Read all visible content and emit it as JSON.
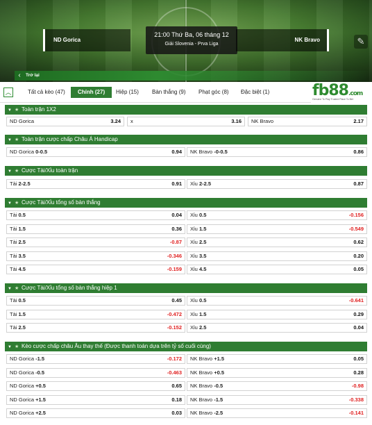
{
  "header": {
    "home_team": "ND Gorica",
    "away_team": "NK Bravo",
    "match_time": "21:00 Thứ Ba, 06 tháng 12",
    "league": "Giải Slovenia - Prva Liga",
    "back_label": "Trở lại",
    "side_icon": "pin-icon"
  },
  "tabs": [
    {
      "label": "Tất cả kèo (47)"
    },
    {
      "label": "Chính (27)"
    },
    {
      "label": "Hiệp (15)"
    },
    {
      "label": "Bàn thắng (9)"
    },
    {
      "label": "Phạt góc (8)"
    },
    {
      "label": "Đặc biệt (1)"
    }
  ],
  "logo": {
    "brand_main": "fb",
    "brand_accent": "88",
    "brand_suffix": ".com",
    "tagline": "Genuine To Play     Trusted Place To Bet"
  },
  "colors": {
    "accent_green": "#2f7d32",
    "negative_red": "#e02020"
  },
  "sections": {
    "s1": {
      "title": "Toàn trận 1X2",
      "rows": [
        [
          {
            "label": "ND Gorica",
            "value": "3.24"
          },
          {
            "label": "x",
            "value": "3.16"
          },
          {
            "label": "NK Bravo",
            "value": "2.17"
          }
        ]
      ]
    },
    "s2": {
      "title": "Toàn trận cược chấp Châu Á Handicap",
      "rows": [
        [
          {
            "label": "ND Gorica",
            "label_bold": "0-0.5",
            "value": "0.94"
          },
          {
            "label": "NK Bravo",
            "label_bold": "-0-0.5",
            "value": "0.86"
          }
        ]
      ]
    },
    "s3": {
      "title": "Cược Tài/Xỉu toàn trận",
      "rows": [
        [
          {
            "label": "Tài",
            "label_bold": "2-2.5",
            "value": "0.91"
          },
          {
            "label": "Xỉu",
            "label_bold": "2-2.5",
            "value": "0.87"
          }
        ]
      ]
    },
    "s4": {
      "title": "Cược Tài/Xỉu tổng số bàn thắng",
      "rows": [
        [
          {
            "label": "Tài",
            "label_bold": "0.5",
            "value": "0.04"
          },
          {
            "label": "Xỉu",
            "label_bold": "0.5",
            "value": "-0.156"
          }
        ],
        [
          {
            "label": "Tài",
            "label_bold": "1.5",
            "value": "0.36"
          },
          {
            "label": "Xỉu",
            "label_bold": "1.5",
            "value": "-0.549"
          }
        ],
        [
          {
            "label": "Tài",
            "label_bold": "2.5",
            "value": "-0.87"
          },
          {
            "label": "Xỉu",
            "label_bold": "2.5",
            "value": "0.62"
          }
        ],
        [
          {
            "label": "Tài",
            "label_bold": "3.5",
            "value": "-0.346"
          },
          {
            "label": "Xỉu",
            "label_bold": "3.5",
            "value": "0.20"
          }
        ],
        [
          {
            "label": "Tài",
            "label_bold": "4.5",
            "value": "-0.159"
          },
          {
            "label": "Xỉu",
            "label_bold": "4.5",
            "value": "0.05"
          }
        ]
      ]
    },
    "s5": {
      "title": "Cược Tài/Xỉu tổng số bàn thắng hiệp 1",
      "rows": [
        [
          {
            "label": "Tài",
            "label_bold": "0.5",
            "value": "0.45"
          },
          {
            "label": "Xỉu",
            "label_bold": "0.5",
            "value": "-0.641"
          }
        ],
        [
          {
            "label": "Tài",
            "label_bold": "1.5",
            "value": "-0.472"
          },
          {
            "label": "Xỉu",
            "label_bold": "1.5",
            "value": "0.29"
          }
        ],
        [
          {
            "label": "Tài",
            "label_bold": "2.5",
            "value": "-0.152"
          },
          {
            "label": "Xỉu",
            "label_bold": "2.5",
            "value": "0.04"
          }
        ]
      ]
    },
    "s6": {
      "title": "Kèo cược chấp châu Âu thay thế (Được thanh toán dựa trên tỷ số cuối cùng)",
      "rows": [
        [
          {
            "label": "ND Gorica",
            "label_bold": "-1.5",
            "value": "-0.172"
          },
          {
            "label": "NK Bravo",
            "label_bold": "+1.5",
            "value": "0.05"
          }
        ],
        [
          {
            "label": "ND Gorica",
            "label_bold": "-0.5",
            "value": "-0.463"
          },
          {
            "label": "NK Bravo",
            "label_bold": "+0.5",
            "value": "0.28"
          }
        ],
        [
          {
            "label": "ND Gorica",
            "label_bold": "+0.5",
            "value": "0.65"
          },
          {
            "label": "NK Bravo",
            "label_bold": "-0.5",
            "value": "-0.98"
          }
        ],
        [
          {
            "label": "ND Gorica",
            "label_bold": "+1.5",
            "value": "0.18"
          },
          {
            "label": "NK Bravo",
            "label_bold": "-1.5",
            "value": "-0.338"
          }
        ],
        [
          {
            "label": "ND Gorica",
            "label_bold": "+2.5",
            "value": "0.03"
          },
          {
            "label": "NK Bravo",
            "label_bold": "-2.5",
            "value": "-0.141"
          }
        ]
      ]
    }
  }
}
